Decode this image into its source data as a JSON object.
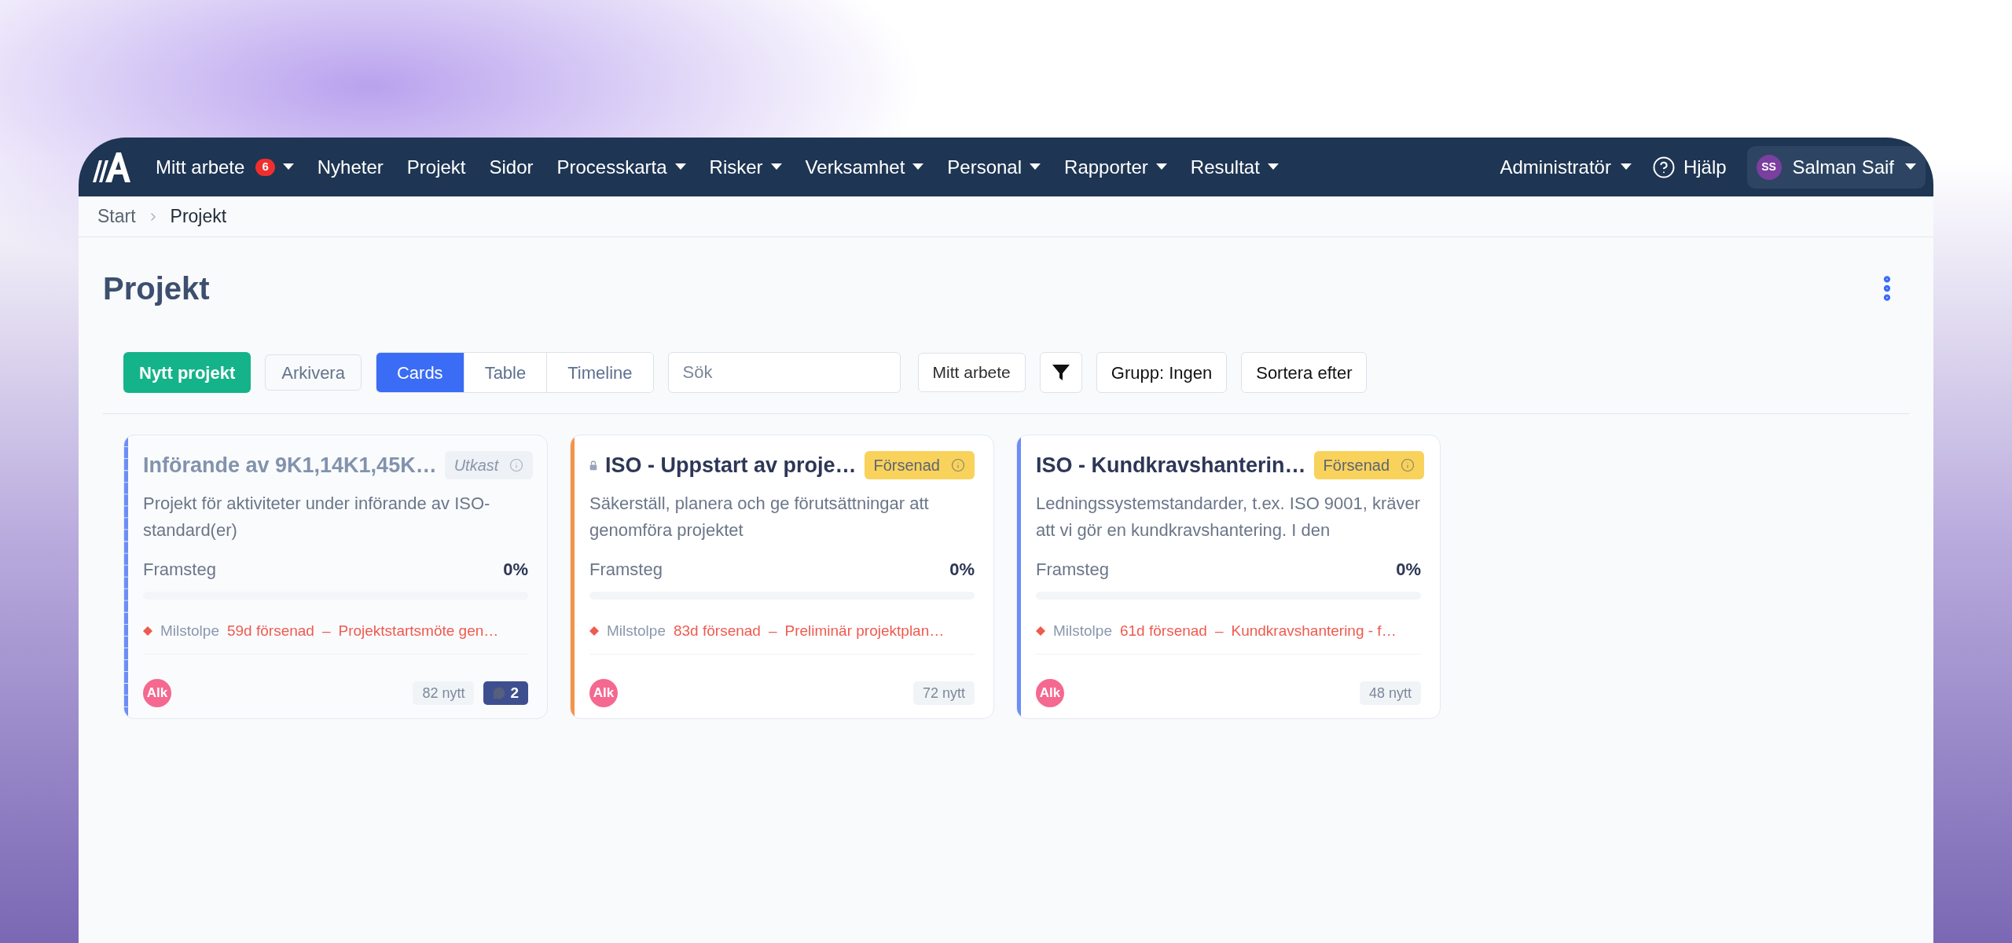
{
  "nav": {
    "items": [
      {
        "label": "Mitt arbete",
        "badge": "6",
        "dropdown": true
      },
      {
        "label": "Nyheter",
        "dropdown": false
      },
      {
        "label": "Projekt",
        "dropdown": false
      },
      {
        "label": "Sidor",
        "dropdown": false
      },
      {
        "label": "Processkarta",
        "dropdown": true
      },
      {
        "label": "Risker",
        "dropdown": true
      },
      {
        "label": "Verksamhet",
        "dropdown": true
      },
      {
        "label": "Personal",
        "dropdown": true
      },
      {
        "label": "Rapporter",
        "dropdown": true
      },
      {
        "label": "Resultat",
        "dropdown": true
      }
    ],
    "admin": "Administratör",
    "help": "Hjälp",
    "user": {
      "initials": "SS",
      "name": "Salman Saif"
    }
  },
  "breadcrumb": [
    "Start",
    "Projekt"
  ],
  "page_title": "Projekt",
  "toolbar": {
    "new_button": "Nytt projekt",
    "archive_button": "Arkivera",
    "views": [
      {
        "label": "Cards",
        "selected": true
      },
      {
        "label": "Table",
        "selected": false
      },
      {
        "label": "Timeline",
        "selected": false
      }
    ],
    "search": {
      "placeholder": "Sök"
    },
    "my_work_button": "Mitt arbete",
    "group_button": "Grupp: Ingen",
    "sort_button": "Sortera efter"
  },
  "cards": [
    {
      "title": "Införande av 9K1,14K1,45K…",
      "locked": false,
      "color": "#6b8ef7",
      "status": {
        "label": "Utkast",
        "kind": "draft"
      },
      "description": "Projekt för aktiviteter under införande av ISO-standard(er)",
      "progress_label": "Framsteg",
      "progress_value": "0%",
      "level": 0,
      "milestone": {
        "label": "Milstolpe",
        "delay": "59d försenad",
        "separator": "–",
        "name": "Projektstartsmöte gen…"
      },
      "assignee": "Alk",
      "new_count": "82 nytt",
      "comments": "2"
    },
    {
      "title": "ISO - Uppstart av proje…",
      "locked": true,
      "color": "#f5934a",
      "status": {
        "label": "Försenad",
        "kind": "late"
      },
      "description": "Säkerställ, planera och ge förutsättningar att genomföra projektet",
      "progress_label": "Framsteg",
      "progress_value": "0%",
      "level": 0,
      "milestone": {
        "label": "Milstolpe",
        "delay": "83d försenad",
        "separator": "–",
        "name": "Preliminär projektplan…"
      },
      "assignee": "Alk",
      "new_count": "72 nytt"
    },
    {
      "title": "ISO - Kundkravshanterin…",
      "locked": false,
      "color": "#6b8ef7",
      "status": {
        "label": "Försenad",
        "kind": "late"
      },
      "description": "Ledningssystemstandarder, t.ex. ISO 9001, kräver att vi gör en kundkravshantering. I den",
      "progress_label": "Framsteg",
      "progress_value": "0%",
      "level": 0,
      "milestone": {
        "label": "Milstolpe",
        "delay": "61d försenad",
        "separator": "–",
        "name": "Kundkravshantering - f…"
      },
      "assignee": "Alk",
      "new_count": "48 nytt"
    }
  ]
}
